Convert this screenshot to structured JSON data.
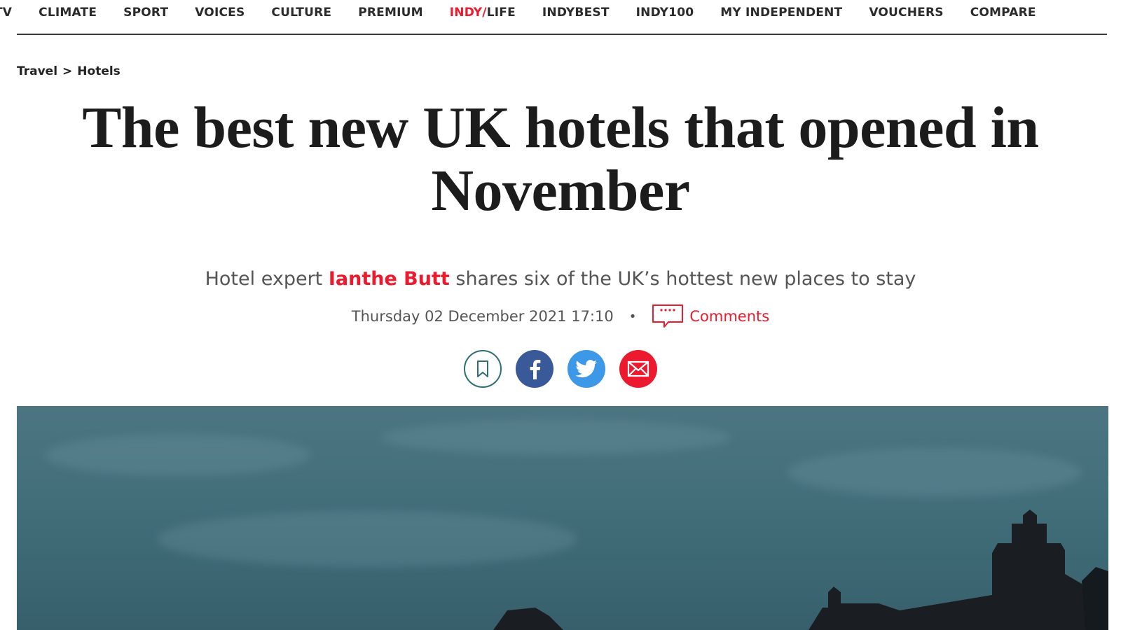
{
  "nav": {
    "items": [
      {
        "label": "TV"
      },
      {
        "label": "CLIMATE"
      },
      {
        "label": "SPORT"
      },
      {
        "label": "VOICES"
      },
      {
        "label": "CULTURE"
      },
      {
        "label": "PREMIUM"
      },
      {
        "label_accent": "INDY/",
        "label_rest": "LIFE"
      },
      {
        "label": "INDYBEST"
      },
      {
        "label": "INDY100"
      },
      {
        "label": "MY INDEPENDENT"
      },
      {
        "label": "VOUCHERS"
      },
      {
        "label": "COMPARE"
      }
    ]
  },
  "breadcrumb": {
    "section": "Travel",
    "separator": ">",
    "subsection": "Hotels"
  },
  "article": {
    "title": "The best new UK hotels that opened in November",
    "standfirst_before": "Hotel expert ",
    "author": "Ianthe Butt",
    "standfirst_after": " shares six of the UK’s hottest new places to stay",
    "date": "Thursday 02 December 2021 17:10",
    "comments_label": "Comments"
  },
  "share": {
    "icons": [
      "bookmark-icon",
      "facebook-icon",
      "twitter-icon",
      "email-icon"
    ]
  },
  "colors": {
    "accent": "#ec1a2e",
    "facebook": "#3a5998",
    "twitter": "#3d98e8",
    "bookmark_ring": "#2d6f73",
    "hero_sky": "#44707c",
    "hero_silhouette": "#1a1e22"
  }
}
